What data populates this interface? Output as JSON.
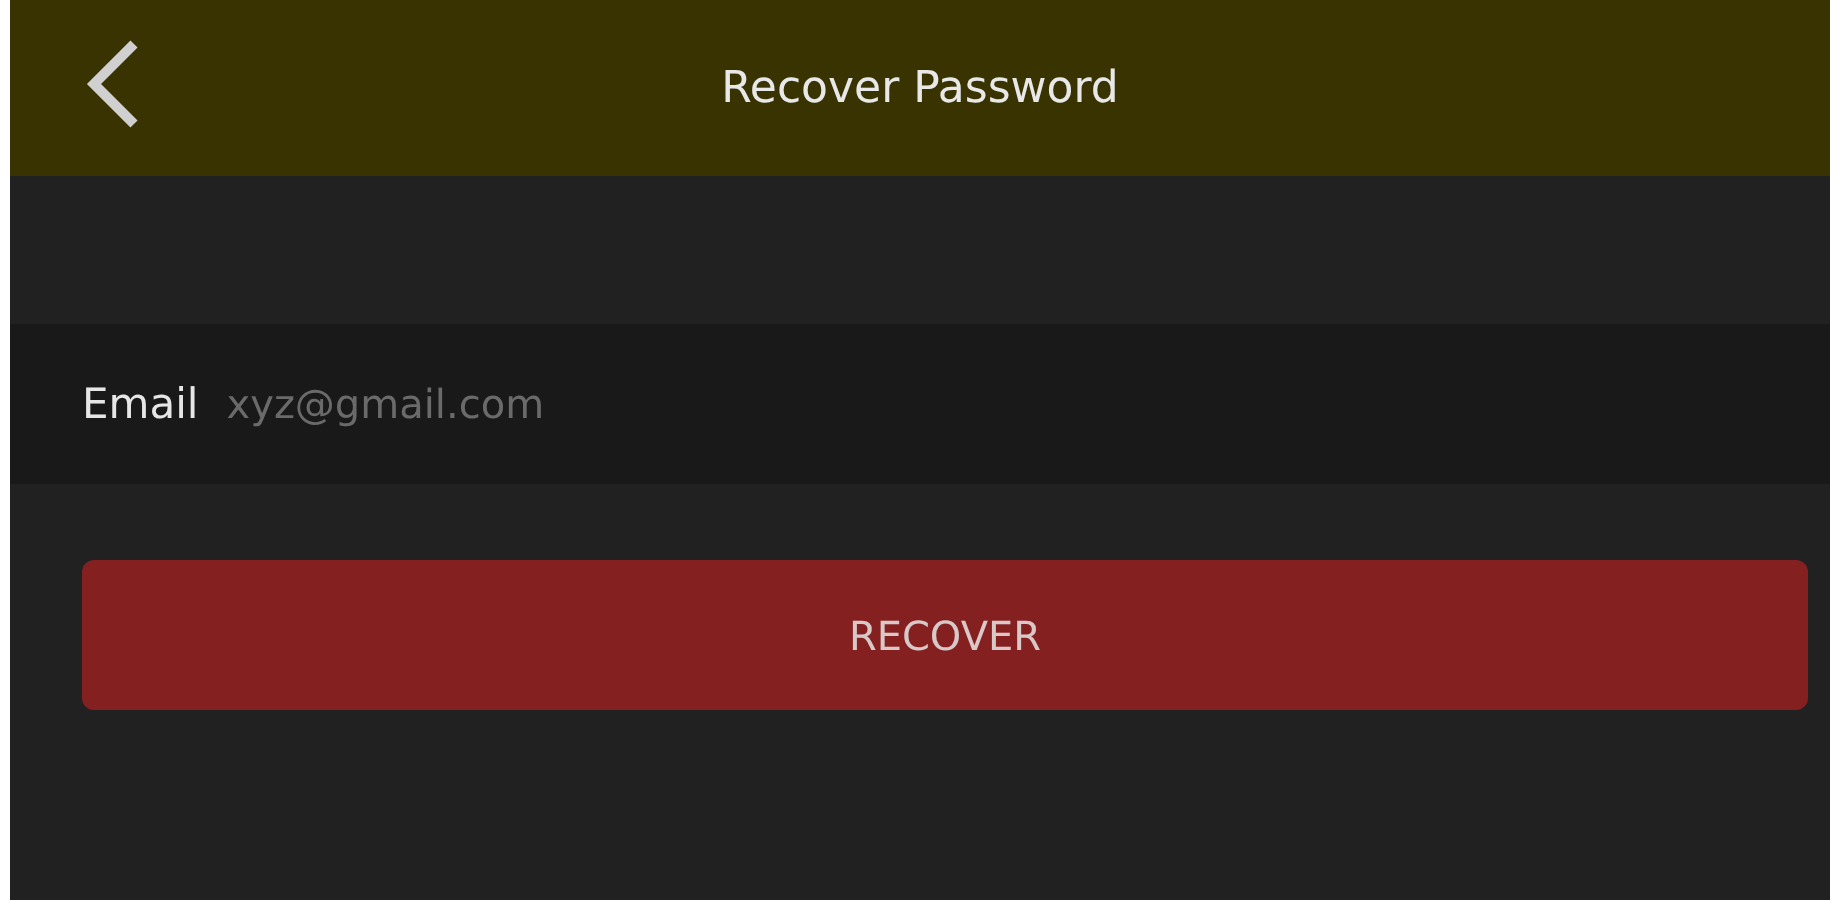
{
  "header": {
    "title": "Recover Password"
  },
  "email_field": {
    "label": "Email",
    "placeholder": "xyz@gmail.com"
  },
  "recover_button": {
    "label": "RECOVER"
  }
}
